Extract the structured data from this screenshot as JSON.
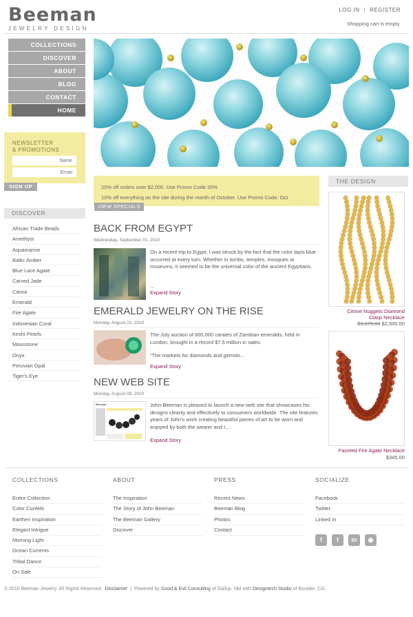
{
  "header": {
    "logo_name": "Beeman",
    "logo_sub": "JEWELRY DESIGN",
    "login": "LOG IN",
    "separator": "|",
    "register": "REGISTER",
    "cart_status": "Shopping cart is empty."
  },
  "nav": {
    "items": [
      "COLLECTIONS",
      "DISCOVER",
      "ABOUT",
      "BLOG",
      "CONTACT",
      "HOME"
    ],
    "active": "HOME"
  },
  "newsletter": {
    "title_line1": "NEWSLETTER",
    "title_line2": "& PROMOTIONS",
    "name_placeholder": "Name",
    "email_placeholder": "Email",
    "signup_label": "SIGN UP"
  },
  "discover": {
    "heading": "DISCOVER",
    "items": [
      "African Trade Beads",
      "Amethyst",
      "Aquamarine",
      "Baltic Amber",
      "Blue Lace Agate",
      "Carved Jade",
      "Citrine",
      "Emerald",
      "Fire Agate",
      "Indonesian Coral",
      "Keshi Pearls",
      "Moonstone",
      "Onyx",
      "Peruvian Opal",
      "Tiger's Eye"
    ]
  },
  "specials": {
    "line1": "20% off orders over $2,000. Use Promo Code 20%",
    "line2": "10% off everything on the site during the month of October. Use Promo Code: Oct",
    "button": "VIEW SPECIALS"
  },
  "stories": [
    {
      "title": "BACK FROM EGYPT",
      "date": "Wednesday, September 01, 2010",
      "body": "On a recent trip to Egypt, I was struck by the fact that the color lapis blue occurred at every turn. Whether in tombs, temples, mosques or museums, it seemed to be the universal color of the ancient Egyptians.",
      "ellipsis": "...",
      "expand": "Expand Story"
    },
    {
      "title": "EMERALD JEWELRY ON THE RISE",
      "date": "Monday, August 23, 2010",
      "body": "The July auction of 800,000 carates of Zambian emeralds, held in London, brought in a record $7.5 million in sales.",
      "body2": "\"The markets for diamonds and gemsto...",
      "expand": "Expand Story"
    },
    {
      "title": "NEW WEB SITE",
      "date": "Monday, August 09, 2010",
      "body": "John Beeman is pleased to launch a new web site that showcases his designs cleanly and effectively to consumers worldwide. The site features years of John's work creating beautiful pieces of art to be worn and enjoyed by both the wearer and t...",
      "thumb_label": "Beeman",
      "expand": "Expand Story"
    }
  ],
  "design": {
    "heading": "THE DESIGN",
    "products": [
      {
        "name_line1": "Citrine Nuggets Diamond",
        "name_line2": "Clasp Necklace",
        "old_price": "$3,375.00",
        "price": "$2,500.00",
        "color": "#d9a93a"
      },
      {
        "name_line1": "Faceted Fire Agate Necklace",
        "name_line2": "",
        "old_price": "",
        "price": "$345.00",
        "color": "#b0431e"
      }
    ]
  },
  "footer": {
    "columns": [
      {
        "heading": "COLLECTIONS",
        "items": [
          "Entire Collection",
          "Color Confetti",
          "Earthen Inspiration",
          "Elegant Intrigue",
          "Morning Light",
          "Ocean Currents",
          "Tribal Dance",
          "On Sale"
        ]
      },
      {
        "heading": "ABOUT",
        "items": [
          "The Inspiration",
          "The Story of John Beeman",
          "The Beeman Gallery",
          "Discover"
        ]
      },
      {
        "heading": "PRESS",
        "items": [
          "Recent News",
          "Beeman Blog",
          "Photos",
          "Contact"
        ]
      },
      {
        "heading": "SOCIALIZE",
        "items": [
          "Facebook",
          "Twitter",
          "Linked In"
        ]
      }
    ],
    "social_icons": [
      {
        "name": "facebook-icon",
        "glyph": "f"
      },
      {
        "name": "twitter-icon",
        "glyph": "t"
      },
      {
        "name": "linkedin-icon",
        "glyph": "in"
      },
      {
        "name": "rss-icon",
        "glyph": "◉"
      }
    ],
    "copyright": "© 2010 Beeman Jewelry. All Rights Reserved.",
    "disclaimer": "Disclaimer",
    "sep": "|",
    "powered_prefix": "Powered by",
    "powered_by": "Good & Evil Consulting",
    "powered_mid": "of Gallup, NM with",
    "studio": "Designtech Studio",
    "powered_suffix": "of Boulder, CO."
  },
  "colors": {
    "accent_yellow": "#f3eba0",
    "nav_gray": "#a8a8a8",
    "link_purple": "#8a1a5a",
    "bead_turquoise": "#7fd0dc"
  }
}
